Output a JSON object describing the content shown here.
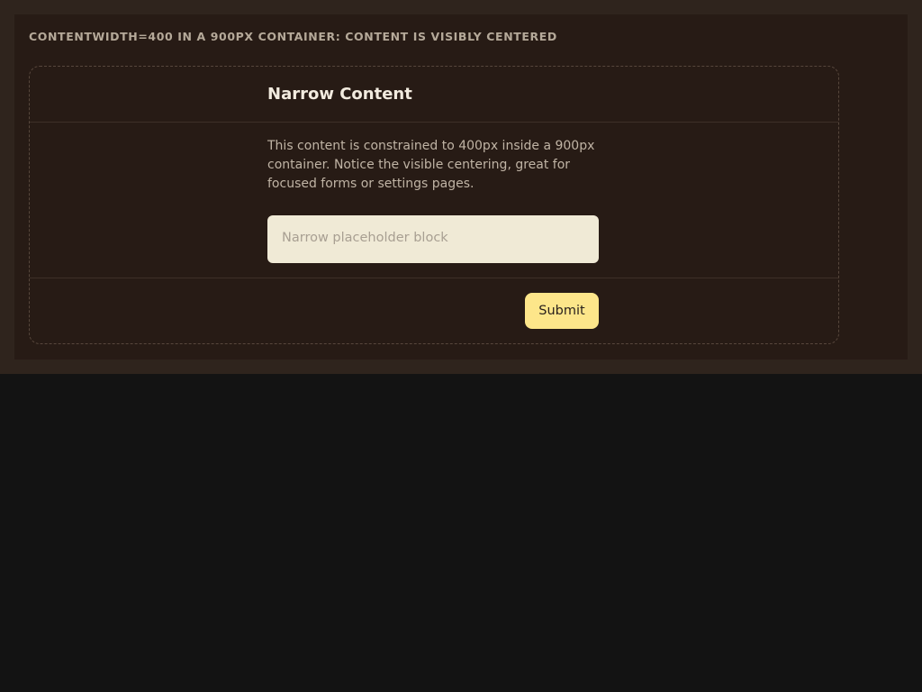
{
  "header": {
    "caption": "CONTENTWIDTH=400 IN A 900PX CONTAINER: CONTENT IS VISIBLY CENTERED"
  },
  "card": {
    "title": "Narrow Content",
    "description": "This content is constrained to 400px inside a 900px container. Notice the visible centering, great for focused forms or settings pages.",
    "placeholder_block_label": "Narrow placeholder block",
    "submit_label": "Submit"
  },
  "colors": {
    "page_background": "#131313",
    "outer_band": "#2f241d",
    "panel_background": "#271b15",
    "placeholder_block": "#f0ead6",
    "submit_button": "#fde68a",
    "title_text": "#f2ebdf",
    "body_text": "#c0b4a5"
  }
}
